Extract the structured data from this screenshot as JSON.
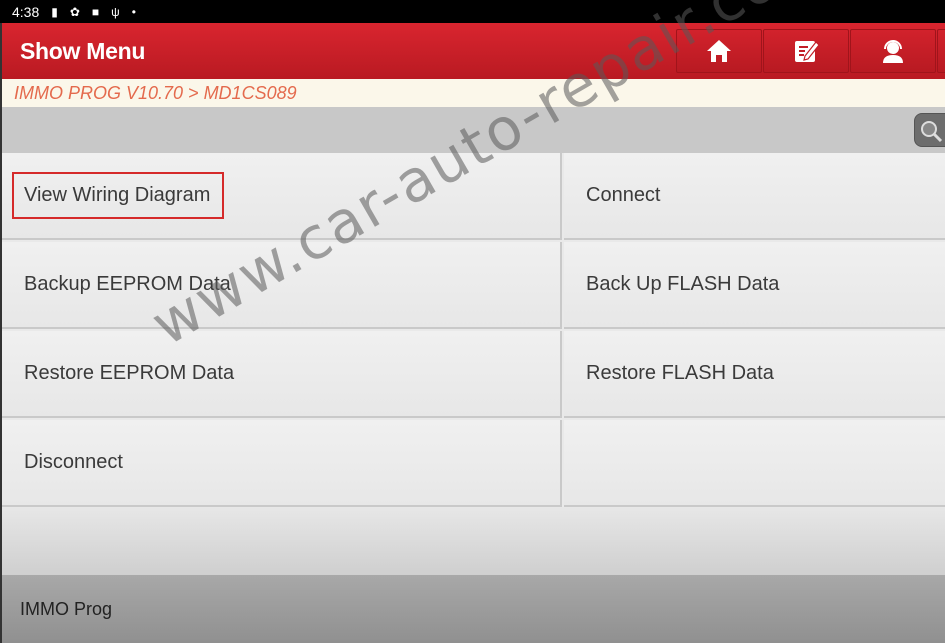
{
  "status_bar": {
    "time": "4:38",
    "icons": [
      "battery-icon",
      "settings-gear-icon",
      "video-camera-icon",
      "usb-icon",
      "dot-icon"
    ]
  },
  "header": {
    "title": "Show Menu",
    "buttons": [
      {
        "name": "home",
        "icon": "home-icon"
      },
      {
        "name": "edit-report",
        "icon": "edit-note-icon"
      },
      {
        "name": "support",
        "icon": "headset-user-icon"
      }
    ],
    "accent_color": "#d2222c"
  },
  "breadcrumb": "IMMO PROG V10.70 > MD1CS089",
  "search": {
    "icon": "search-icon"
  },
  "menu": {
    "items": [
      {
        "label": "View Wiring Diagram",
        "highlighted": true
      },
      {
        "label": "Connect"
      },
      {
        "label": "Backup EEPROM Data"
      },
      {
        "label": "Back Up FLASH Data"
      },
      {
        "label": "Restore EEPROM Data"
      },
      {
        "label": "Restore FLASH Data"
      },
      {
        "label": "Disconnect"
      },
      {
        "label": ""
      }
    ]
  },
  "footer": {
    "label": "IMMO Prog"
  },
  "watermark": "www.car-auto-repair.com"
}
